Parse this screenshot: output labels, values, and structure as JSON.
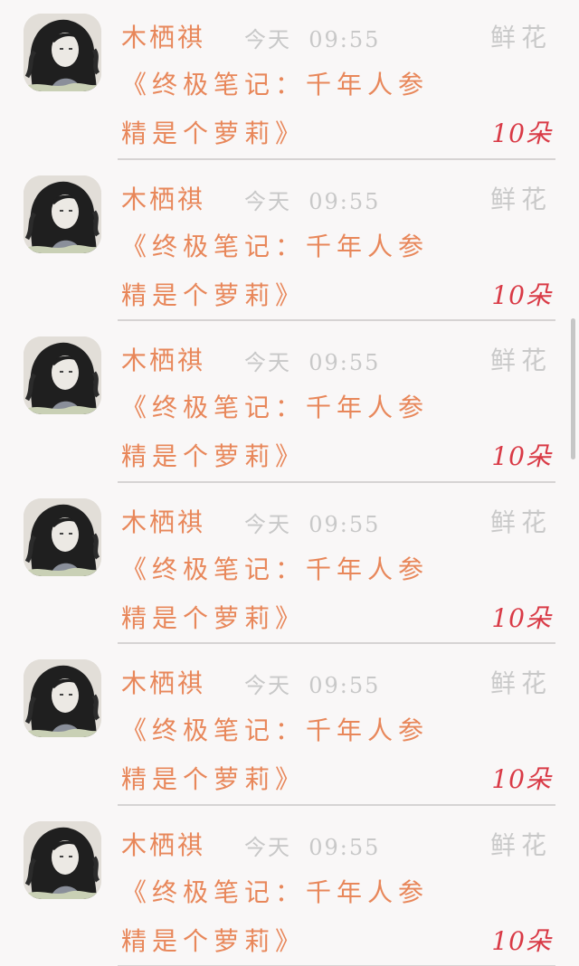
{
  "messages": [
    {
      "sender": "木栖祺",
      "time": "今天  09:55",
      "gift_type": "鲜花",
      "title_line1": "《终极笔记：千年人参",
      "title_line2": "精是个萝莉》",
      "count": "10朵"
    },
    {
      "sender": "木栖祺",
      "time": "今天  09:55",
      "gift_type": "鲜花",
      "title_line1": "《终极笔记：千年人参",
      "title_line2": "精是个萝莉》",
      "count": "10朵"
    },
    {
      "sender": "木栖祺",
      "time": "今天  09:55",
      "gift_type": "鲜花",
      "title_line1": "《终极笔记：千年人参",
      "title_line2": "精是个萝莉》",
      "count": "10朵"
    },
    {
      "sender": "木栖祺",
      "time": "今天  09:55",
      "gift_type": "鲜花",
      "title_line1": "《终极笔记：千年人参",
      "title_line2": "精是个萝莉》",
      "count": "10朵"
    },
    {
      "sender": "木栖祺",
      "time": "今天  09:55",
      "gift_type": "鲜花",
      "title_line1": "《终极笔记：千年人参",
      "title_line2": "精是个萝莉》",
      "count": "10朵"
    },
    {
      "sender": "木栖祺",
      "time": "今天  09:55",
      "gift_type": "鲜花",
      "title_line1": "《终极笔记：千年人参",
      "title_line2": "精是个萝莉》",
      "count": "10朵"
    }
  ],
  "colors": {
    "sender": "#e8875a",
    "title": "#e8875a",
    "time": "#c8c8c8",
    "gift_type": "#c9c9c9",
    "count": "#d93a46",
    "background": "#f9f7f7"
  },
  "icons": {
    "avatar": "avatar-illustration"
  }
}
